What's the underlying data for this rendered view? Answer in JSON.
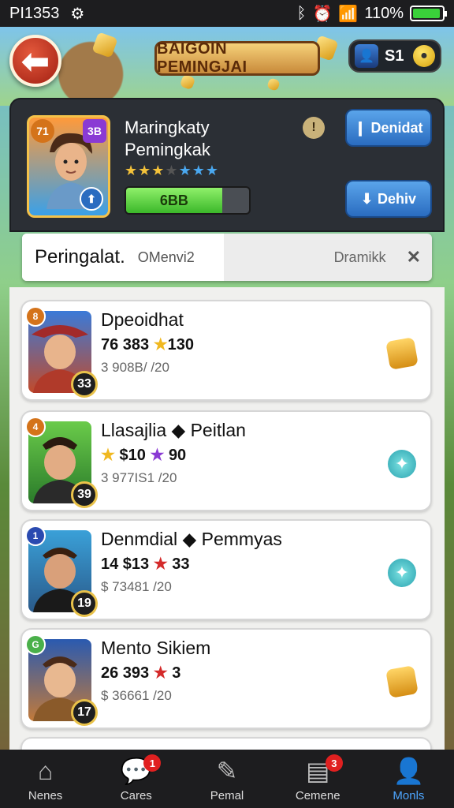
{
  "status_bar": {
    "time": "PI1353",
    "battery": "110%",
    "battery_level": 0.95
  },
  "header": {
    "banner": "BAIGOIN PEMINGJAI",
    "currency_value": "S1"
  },
  "hero": {
    "level_badge": "71",
    "rank_badge": "3B",
    "name_line1": "Maringkaty",
    "name_line2": "Pemingkak",
    "stars": "★★★★★★★",
    "progress_label": "6BB",
    "progress_fraction": 0.78,
    "btn_primary": "Denidat",
    "btn_secondary": "Dehiv"
  },
  "tabs": {
    "active_title": "Peringalat.",
    "active_sub": "OMenvi2",
    "right_label": "Dramikk",
    "close": "✕"
  },
  "list": [
    {
      "name": "Dpeoidhat",
      "stats_a": "76 383",
      "stats_b": "130",
      "sub": "3 908B/ /20",
      "rank": "33",
      "mini": "8",
      "action": "gold"
    },
    {
      "name": "Llasajlia ◆ Peitlan",
      "stats_a": "$10",
      "stats_b": "90",
      "sub": "3 977IS1 /20",
      "rank": "39",
      "mini": "4",
      "action": "teal"
    },
    {
      "name": "Denmdial ◆ Pemmyas",
      "stats_a": "14 $13",
      "stats_b": "33",
      "sub": "$ 73481 /20",
      "rank": "19",
      "mini": "1",
      "action": "teal"
    },
    {
      "name": "Mento Sikiem",
      "stats_a": "26 393",
      "stats_b": "3",
      "sub": "$ 36661 /20",
      "rank": "17",
      "mini": "G",
      "action": "gold"
    }
  ],
  "bottom_nav": [
    {
      "label": "Nenes",
      "icon": "home-icon",
      "badge": ""
    },
    {
      "label": "Cares",
      "icon": "chat-icon",
      "badge": "1"
    },
    {
      "label": "Pemal",
      "icon": "edit-icon",
      "badge": ""
    },
    {
      "label": "Cemene",
      "icon": "calendar-icon",
      "badge": "3"
    },
    {
      "label": "Monls",
      "icon": "profile-icon",
      "badge": ""
    }
  ]
}
